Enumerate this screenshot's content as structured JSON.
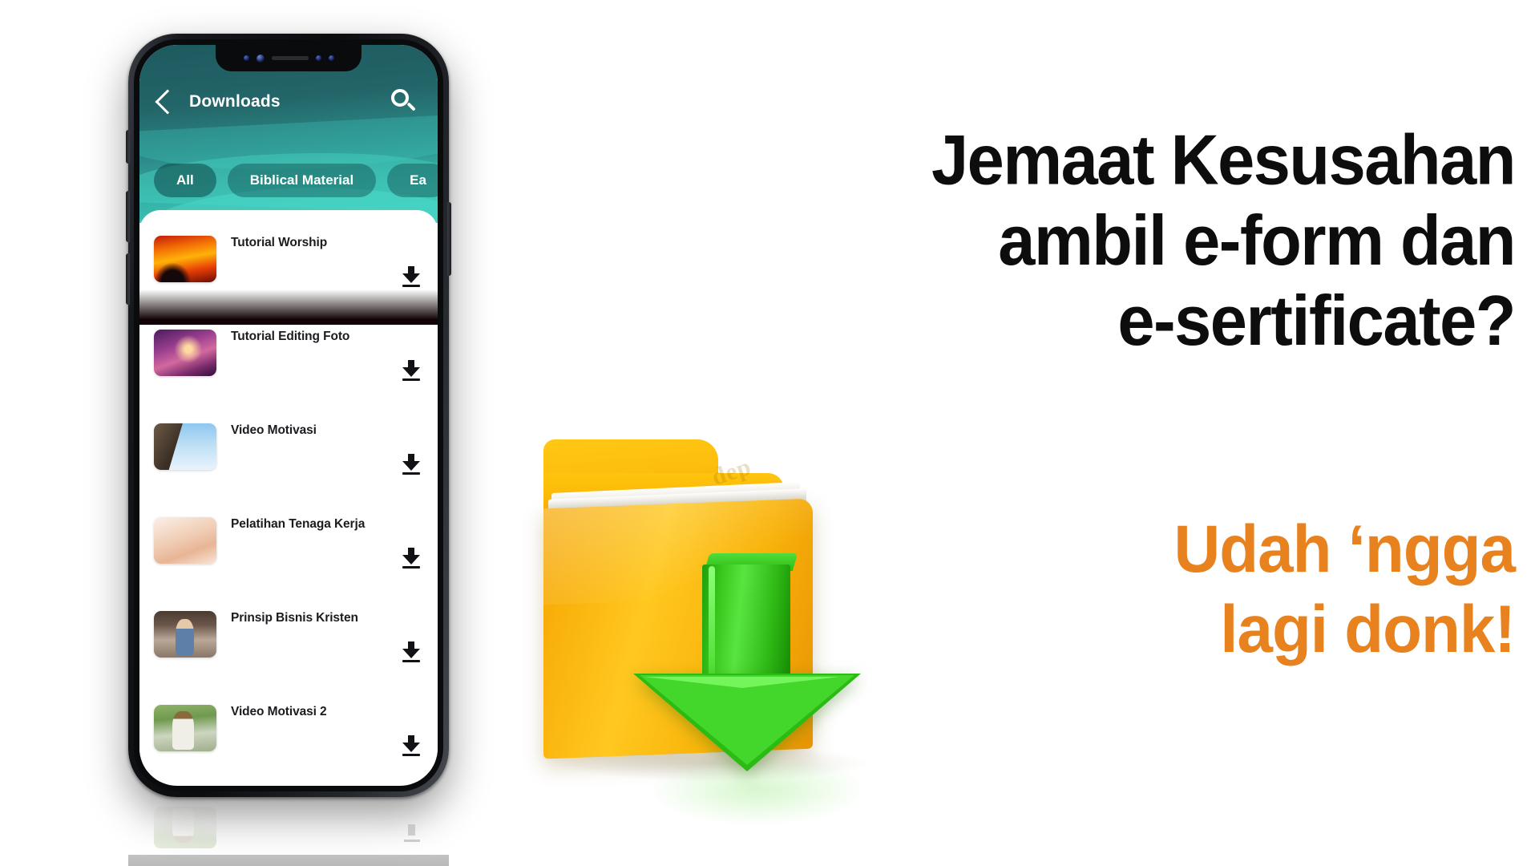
{
  "promo": {
    "headline_lines": [
      "Jemaat Kesusahan",
      "ambil e-form dan",
      "e-sertificate?"
    ],
    "subhead_lines": [
      "Udah ‘ngga",
      "lagi donk!"
    ],
    "headline_color": "#0d0d0d",
    "subhead_color": "#e8821e"
  },
  "graphic": {
    "folder_label": "download-folder-3d",
    "arrow_label": "green-download-arrow-3d",
    "folder_color": "#f9b208",
    "arrow_color": "#2cba14",
    "watermark": "dep"
  },
  "phone": {
    "app": {
      "header": {
        "title": "Downloads",
        "back_icon": "chevron-left-icon",
        "search_icon": "search-icon",
        "gradient_from": "#1d5a5f",
        "gradient_to": "#40cdbe"
      },
      "tabs": [
        {
          "label": "All",
          "active": true
        },
        {
          "label": "Biblical Material",
          "active": false
        },
        {
          "label": "Ea",
          "active": false
        }
      ],
      "downloads": [
        {
          "title": "Tutorial Worship",
          "thumb": "worship-stage-lights-thumb",
          "action_icon": "download-icon"
        },
        {
          "title": "Tutorial Editing Foto",
          "thumb": "photo-editing-portrait-thumb",
          "action_icon": "download-icon"
        },
        {
          "title": "Video Motivasi",
          "thumb": "rock-climber-thumb",
          "action_icon": "download-icon"
        },
        {
          "title": "Pelatihan Tenaga Kerja",
          "thumb": "hands-craft-thumb",
          "action_icon": "download-icon"
        },
        {
          "title": "Prinsip Bisnis Kristen",
          "thumb": "barista-cafe-thumb",
          "action_icon": "download-icon"
        },
        {
          "title": "Video Motivasi 2",
          "thumb": "man-hat-coffee-thumb",
          "action_icon": "download-icon"
        }
      ]
    }
  }
}
